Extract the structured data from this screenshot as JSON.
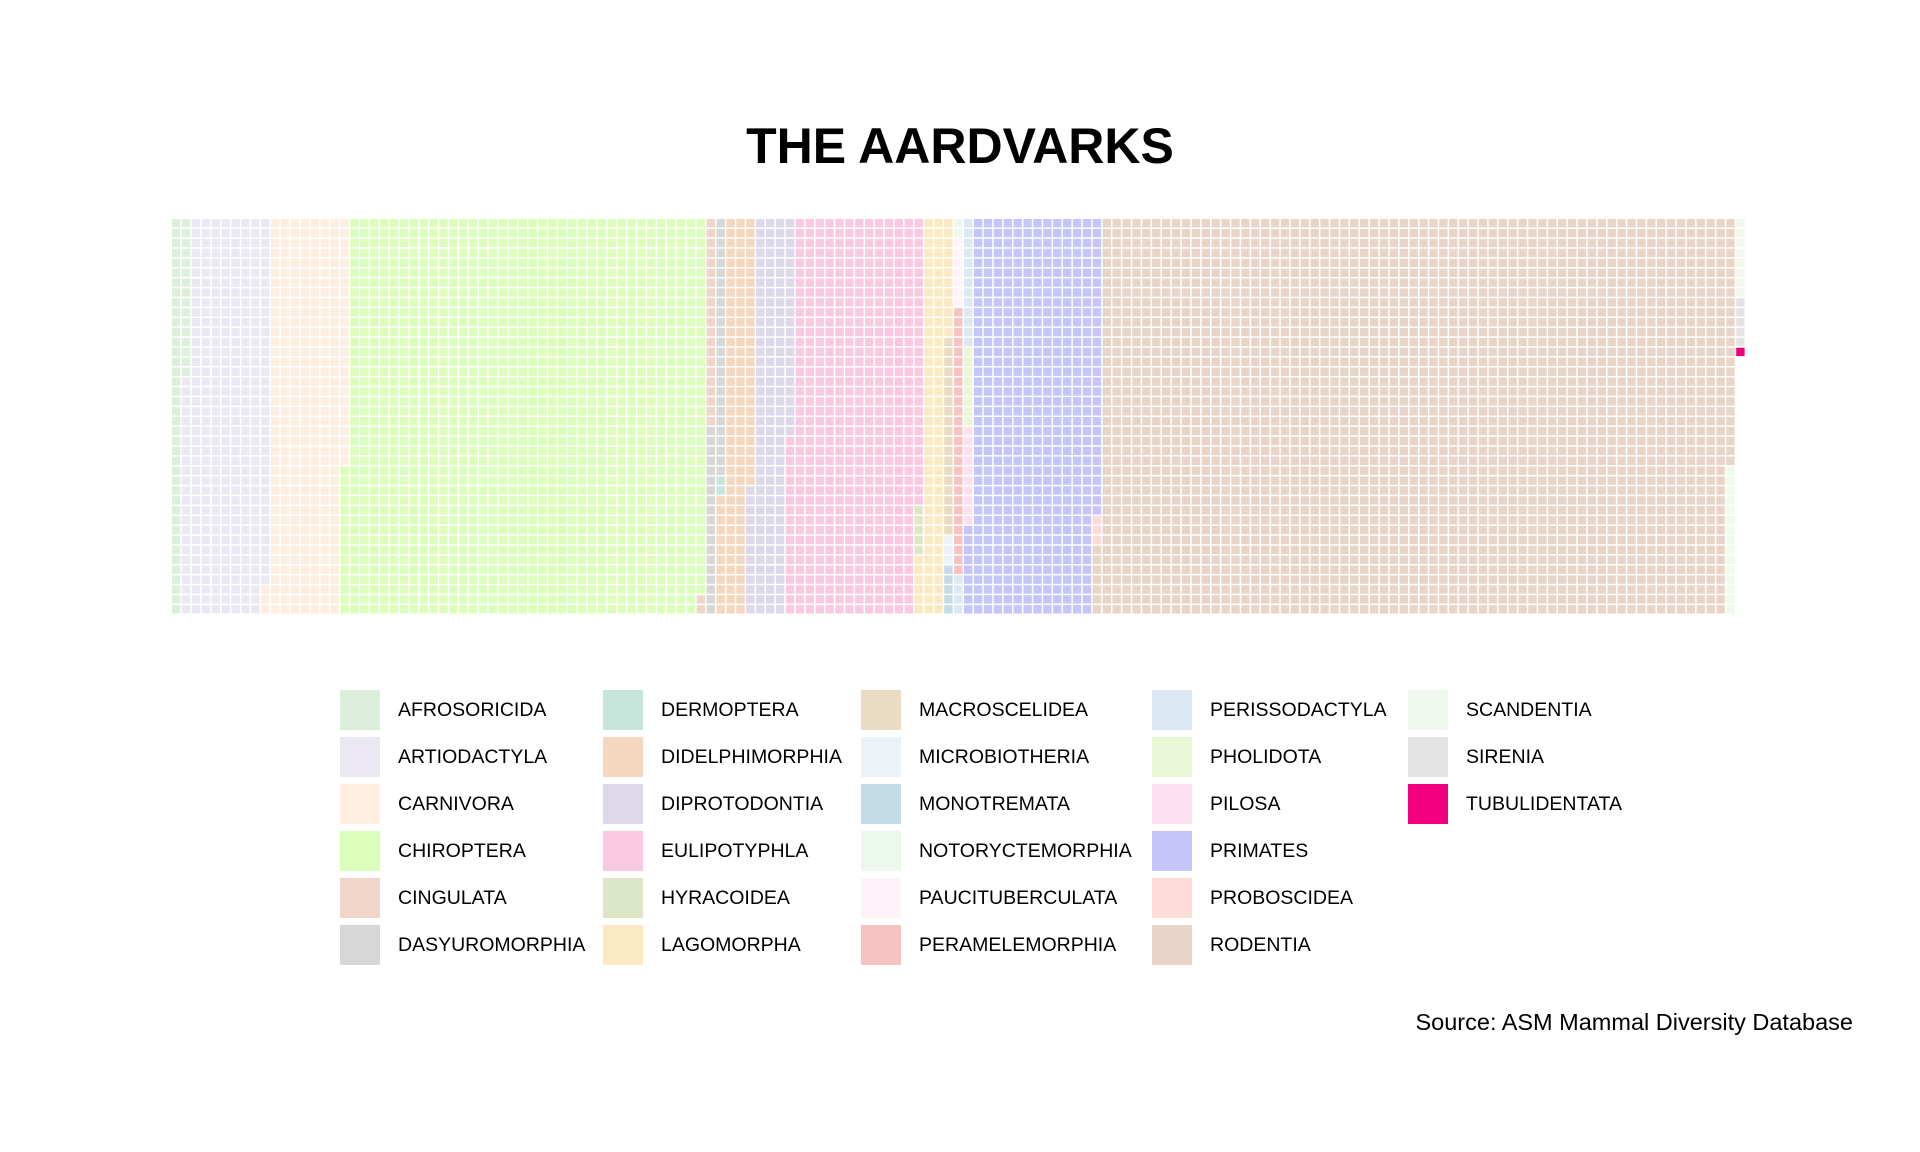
{
  "title": "THE AARDVARKS",
  "caption": "Source: ASM Mammal Diversity Database",
  "chart_data": {
    "type": "waffle",
    "title": "THE AARDVARKS",
    "grid": {
      "rows": 40,
      "columns": 162,
      "fill_order": "column-wise, top to bottom, left to right",
      "unit": "1 species per square"
    },
    "categories": [
      {
        "name": "AFROSORICIDA",
        "count": 56,
        "color": "#dcefdc"
      },
      {
        "name": "ARTIODACTYLA",
        "count": 341,
        "color": "#ece8f3"
      },
      {
        "name": "CARNIVORA",
        "count": 308,
        "color": "#fdeee0"
      },
      {
        "name": "CHIROPTERA",
        "count": 1453,
        "color": "#dcfebb"
      },
      {
        "name": "CINGULATA",
        "count": 23,
        "color": "#f0d5c8"
      },
      {
        "name": "DASYUROMORPHIA",
        "count": 45,
        "color": "#d7d7d7"
      },
      {
        "name": "DERMOPTERA",
        "count": 2,
        "color": "#c6e6dc"
      },
      {
        "name": "DIDELPHIMORPHIA",
        "count": 119,
        "color": "#f5d6be"
      },
      {
        "name": "DIPROTODONTIA",
        "count": 155,
        "color": "#ddd9ea"
      },
      {
        "name": "EULIPOTYPHLA",
        "count": 527,
        "color": "#f9c8e1"
      },
      {
        "name": "HYRACOIDEA",
        "count": 5,
        "color": "#dce7c8"
      },
      {
        "name": "LAGOMORPHA",
        "count": 98,
        "color": "#fae9c3"
      },
      {
        "name": "MACROSCELIDEA",
        "count": 20,
        "color": "#e9dcc3"
      },
      {
        "name": "MICROBIOTHERIA",
        "count": 3,
        "color": "#ebf2f8"
      },
      {
        "name": "MONOTREMATA",
        "count": 5,
        "color": "#c4dbe8"
      },
      {
        "name": "NOTORYCTEMORPHIA",
        "count": 2,
        "color": "#ecf8ee"
      },
      {
        "name": "PAUCITUBERCULATA",
        "count": 7,
        "color": "#fdf3f8"
      },
      {
        "name": "PERAMELEMORPHIA",
        "count": 27,
        "color": "#f7c3c2"
      },
      {
        "name": "PERISSODACTYLA",
        "count": 17,
        "color": "#dde9f2"
      },
      {
        "name": "PHOLIDOTA",
        "count": 8,
        "color": "#e9f7d7"
      },
      {
        "name": "PILOSA",
        "count": 10,
        "color": "#fddfef"
      },
      {
        "name": "PRIMATES",
        "count": 519,
        "color": "#c6c5fa"
      },
      {
        "name": "PROBOSCIDEA",
        "count": 3,
        "color": "#fddcd8"
      },
      {
        "name": "RODENTIA",
        "count": 2552,
        "color": "#e8d5c8"
      },
      {
        "name": "SCANDENTIA",
        "count": 23,
        "color": "#f1f8ef"
      },
      {
        "name": "SIRENIA",
        "count": 5,
        "color": "#e4e4e4"
      },
      {
        "name": "TUBULIDENTATA",
        "count": 1,
        "color": "#f0007d"
      }
    ]
  }
}
